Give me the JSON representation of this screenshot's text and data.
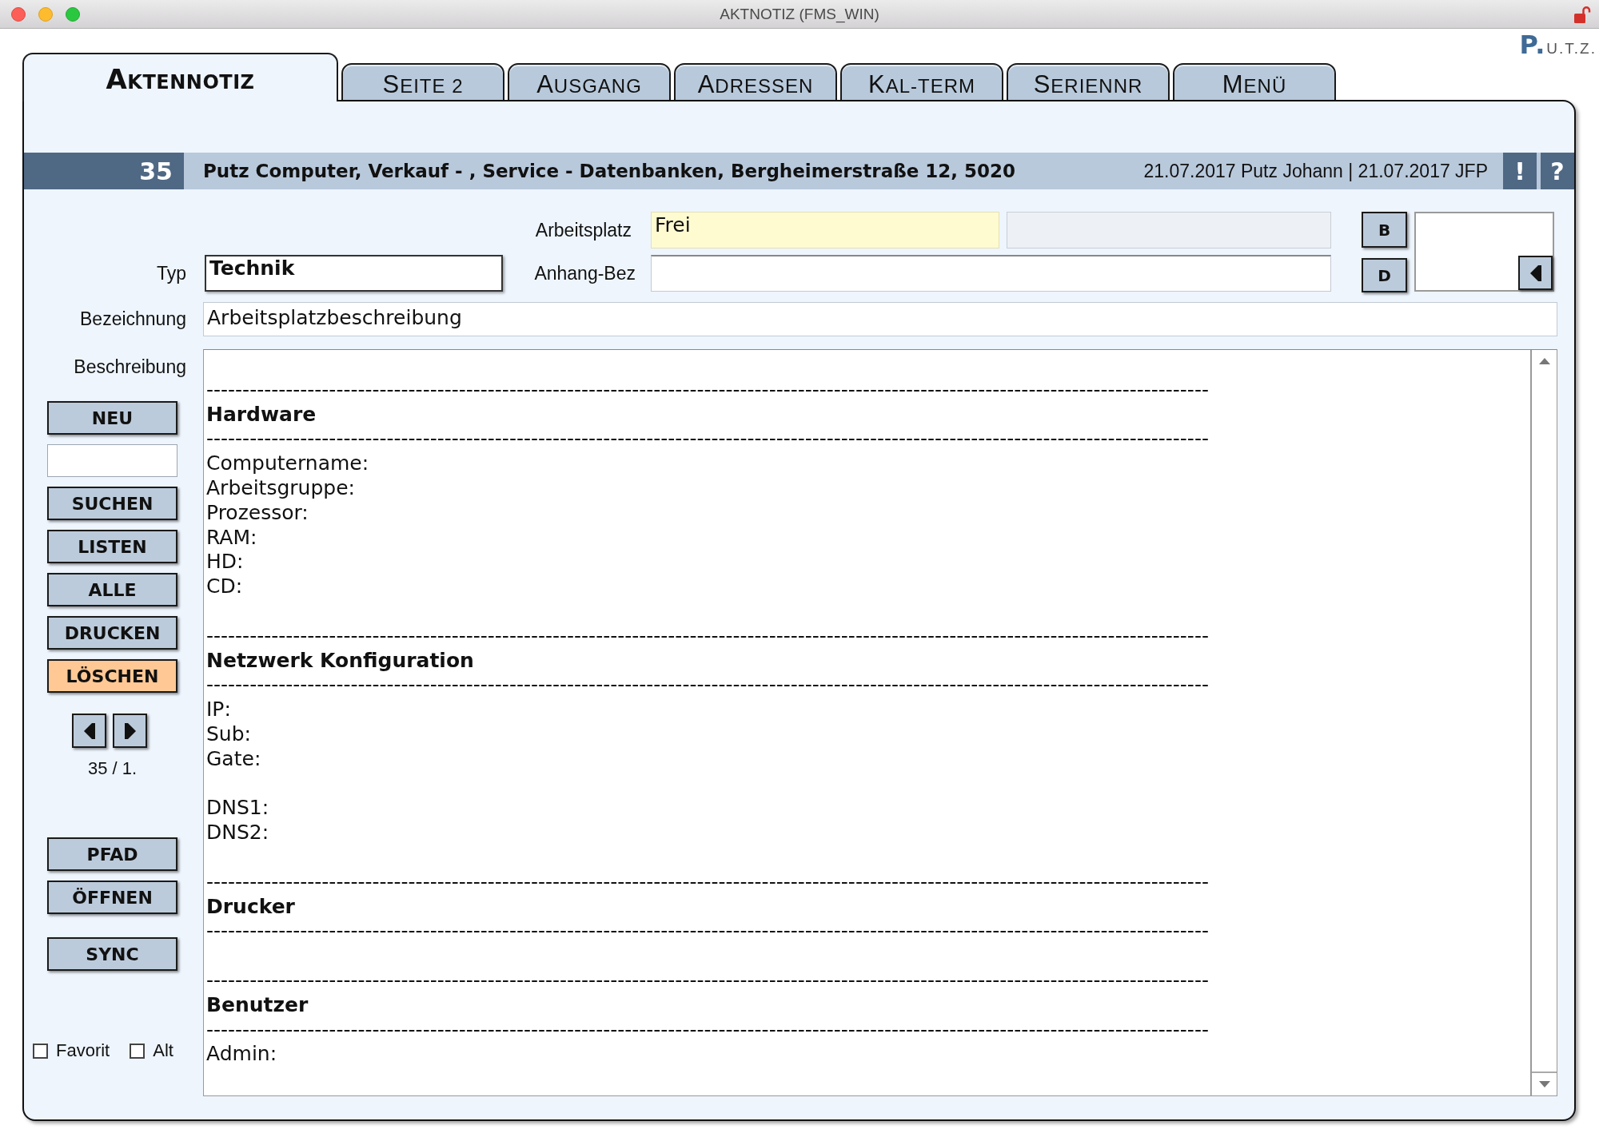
{
  "window": {
    "title": "AKTNOTIZ (FMS_WIN)"
  },
  "logo": "P.U.T.Z.",
  "tabs": [
    {
      "label": "AKTENNOTIZ",
      "selected": true
    },
    {
      "label": "SEITE 2",
      "selected": false
    },
    {
      "label": "AUSGANG",
      "selected": false
    },
    {
      "label": "ADRESSEN",
      "selected": false
    },
    {
      "label": "KAL-TERM",
      "selected": false
    },
    {
      "label": "SERIENNR",
      "selected": false
    },
    {
      "label": "MENÜ",
      "selected": false
    }
  ],
  "record": {
    "number": "35",
    "address": "Putz Computer, Verkauf - , Service - Datenbanken, Bergheimerstraße 12, 5020",
    "modified": "21.07.2017 Putz Johann | 21.07.2017 JFP",
    "actions": [
      "!",
      "?"
    ]
  },
  "form": {
    "arbeitsplatz": {
      "label": "Arbeitsplatz",
      "value": "Frei"
    },
    "typ": {
      "label": "Typ",
      "value": "Technik"
    },
    "anhang_bez": {
      "label": "Anhang-Bez"
    },
    "buttons": [
      "B",
      "D"
    ],
    "bezeichnung": {
      "label": "Bezeichnung",
      "value": "Arbeitsplatzbeschreibung"
    },
    "beschreibung": {
      "label": "Beschreibung",
      "lines": [
        {
          "kind": "blank"
        },
        {
          "kind": "rule",
          "text": "-------------------------------------------------------------------------------------------------------------------------------------------"
        },
        {
          "kind": "heading",
          "text": "Hardware"
        },
        {
          "kind": "rule",
          "text": "-------------------------------------------------------------------------------------------------------------------------------------------"
        },
        {
          "kind": "text",
          "text": "Computername:"
        },
        {
          "kind": "text",
          "text": "Arbeitsgruppe:"
        },
        {
          "kind": "text",
          "text": "Prozessor:"
        },
        {
          "kind": "text",
          "text": "RAM:"
        },
        {
          "kind": "text",
          "text": "HD:"
        },
        {
          "kind": "text",
          "text": "CD:"
        },
        {
          "kind": "blank"
        },
        {
          "kind": "rule",
          "text": "-------------------------------------------------------------------------------------------------------------------------------------------"
        },
        {
          "kind": "heading",
          "text": "Netzwerk Konfiguration"
        },
        {
          "kind": "rule",
          "text": "-------------------------------------------------------------------------------------------------------------------------------------------"
        },
        {
          "kind": "text",
          "text": "IP:"
        },
        {
          "kind": "text",
          "text": "Sub:"
        },
        {
          "kind": "text",
          "text": "Gate:"
        },
        {
          "kind": "blank"
        },
        {
          "kind": "text",
          "text": "DNS1:"
        },
        {
          "kind": "text",
          "text": "DNS2:"
        },
        {
          "kind": "blank"
        },
        {
          "kind": "rule",
          "text": "-------------------------------------------------------------------------------------------------------------------------------------------"
        },
        {
          "kind": "heading",
          "text": "Drucker"
        },
        {
          "kind": "rule",
          "text": "-------------------------------------------------------------------------------------------------------------------------------------------"
        },
        {
          "kind": "blank"
        },
        {
          "kind": "rule",
          "text": "-------------------------------------------------------------------------------------------------------------------------------------------"
        },
        {
          "kind": "heading",
          "text": "Benutzer"
        },
        {
          "kind": "rule",
          "text": "-------------------------------------------------------------------------------------------------------------------------------------------"
        },
        {
          "kind": "text",
          "text": "Admin:"
        }
      ]
    }
  },
  "actions": {
    "top": [
      {
        "kind": "button",
        "label": "NEU"
      },
      {
        "kind": "field"
      },
      {
        "kind": "button",
        "label": "SUCHEN"
      },
      {
        "kind": "button",
        "label": "LISTEN"
      },
      {
        "kind": "button",
        "label": "ALLE"
      },
      {
        "kind": "button",
        "label": "DRUCKEN"
      },
      {
        "kind": "danger",
        "label": "LÖSCHEN"
      }
    ],
    "pager": {
      "counter": "35 / 1."
    },
    "files": [
      {
        "label": "PFAD"
      },
      {
        "label": "ÖFFNEN"
      },
      {
        "label": "SYNC"
      }
    ]
  },
  "flags": [
    {
      "label": "Favorit",
      "checked": false
    },
    {
      "label": "Alt",
      "checked": false
    }
  ]
}
